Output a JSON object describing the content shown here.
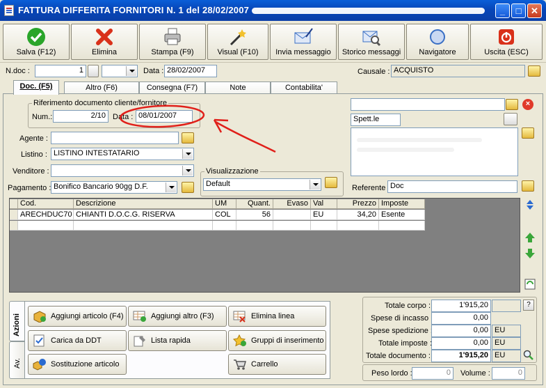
{
  "window": {
    "title": "FATTURA DIFFERITA FORNITORI N. 1   del 28/02/2007",
    "buttons": {
      "minimize": "_",
      "maximize": "□",
      "close": "✕"
    }
  },
  "toolbar": [
    {
      "label": "Salva (F12)",
      "icon": "check-icon",
      "color": "#2aa52a"
    },
    {
      "label": "Elimina",
      "icon": "delete-x-icon",
      "color": "#d9311a"
    },
    {
      "label": "Stampa (F9)",
      "icon": "printer-icon",
      "color": "#888888"
    },
    {
      "label": "Visual (F10)",
      "icon": "magic-wand-icon",
      "color": "#444444"
    },
    {
      "label": "Invia messaggio",
      "icon": "envelope-send-icon",
      "color": "#3a6fc4"
    },
    {
      "label": "Storico messaggi",
      "icon": "envelope-search-icon",
      "color": "#3a6fc4"
    },
    {
      "label": "Navigatore",
      "icon": "compass-icon",
      "color": "#3a6fc4"
    },
    {
      "label": "Uscita (ESC)",
      "icon": "power-icon",
      "color": "#d9311a"
    }
  ],
  "header": {
    "ndoc_label": "N.doc :",
    "ndoc_value": "1",
    "data_label": "Data :",
    "data_value": "28/02/2007",
    "causale_label": "Causale :",
    "causale_value": "ACQUISTO"
  },
  "tabs": [
    "Doc. (F5)",
    "Altro (F6)",
    "Consegna (F7)",
    "Note",
    "Contabilita'"
  ],
  "riferimento": {
    "legend": "Riferimento documento cliente/fornitore",
    "num_label": "Num.:",
    "num_value": "2/10",
    "data_label": "Data :",
    "data_value": "08/01/2007"
  },
  "form": {
    "agente_label": "Agente :",
    "agente_value": "",
    "listino_label": "Listino :",
    "listino_value": "LISTINO INTESTATARIO",
    "venditore_label": "Venditore :",
    "venditore_value": "",
    "pagamento_label": "Pagamento :",
    "pagamento_value": "Bonifico Bancario 90gg D.F.",
    "visualizzazione_legend": "Visualizzazione",
    "visualizzazione_value": "Default"
  },
  "intestatario": {
    "spett": "Spett.le",
    "referente_label": "Referente",
    "referente_value": "Doc"
  },
  "grid": {
    "columns": [
      "Cod.",
      "Descrizione",
      "UM",
      "Quant.",
      "Evaso",
      "Val",
      "Prezzo",
      "Imposte"
    ],
    "rows": [
      [
        "ARECHDUC70",
        "CHIANTI D.O.C.G. RISERVA",
        "COL",
        "56",
        "",
        "EU",
        "34,20",
        "Esente"
      ]
    ]
  },
  "side_tabs": [
    "Azioni",
    "Av."
  ],
  "actions": [
    {
      "label": "Aggiungi articolo (F4)",
      "icon": "add-article-icon"
    },
    {
      "label": "Aggiungi altro (F3)",
      "icon": "add-other-icon"
    },
    {
      "label": "Elimina linea",
      "icon": "delete-line-icon"
    },
    {
      "label": "Carica da DDT",
      "icon": "load-ddt-icon"
    },
    {
      "label": "Lista rapida",
      "icon": "quick-list-icon"
    },
    {
      "label": "Gruppi di inserimento",
      "icon": "insert-groups-icon"
    },
    {
      "label": "Sostituzione articolo",
      "icon": "replace-article-icon"
    },
    {
      "label": "Carrello",
      "icon": "cart-icon"
    }
  ],
  "totals": {
    "corpo_label": "Totale corpo :",
    "corpo_value": "1'915,20",
    "help": "?",
    "incasso_label": "Spese di incasso :",
    "incasso_value": "0,00",
    "spedizione_label": "Spese spedizione :",
    "spedizione_value": "0,00",
    "spedizione_cur": "EU",
    "imposte_label": "Totale imposte :",
    "imposte_value": "0,00",
    "imposte_cur": "EU",
    "documento_label": "Totale documento :",
    "documento_value": "1'915,20",
    "documento_cur": "EU",
    "peso_label": "Peso lordo :",
    "peso_value": "0",
    "volume_label": "Volume :",
    "volume_value": "0"
  }
}
